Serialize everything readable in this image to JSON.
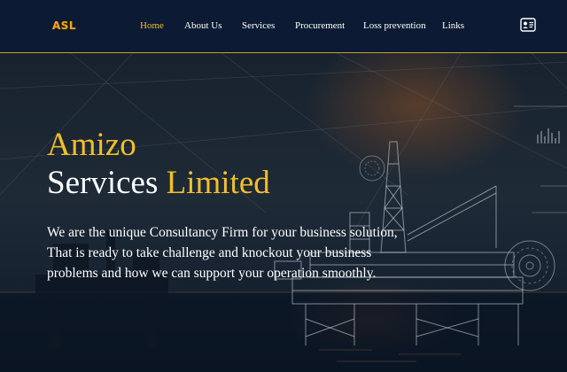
{
  "brand": {
    "logo_text": "ASL"
  },
  "nav": {
    "items": [
      {
        "label": "Home",
        "active": true
      },
      {
        "label": "About Us",
        "active": false
      },
      {
        "label": "Services",
        "active": false
      },
      {
        "label": "Procurement",
        "active": false
      },
      {
        "label": "Loss prevention",
        "active": false
      },
      {
        "label": "Links",
        "active": false
      }
    ],
    "contact_icon": "contact-card-icon"
  },
  "hero": {
    "title_line1": "Amizo",
    "title_line2_a": "Services",
    "title_line2_b": "Limited",
    "description_lines": [
      "We are the unique Consultancy Firm for your business solution,",
      "That is ready to take challenge and knockout your business",
      "problems and how we can support your operation smoothly."
    ]
  },
  "colors": {
    "nav_background": "#0c1b33",
    "accent": "#f2bf29",
    "logo": "#f5a21a",
    "text": "#ffffff"
  }
}
